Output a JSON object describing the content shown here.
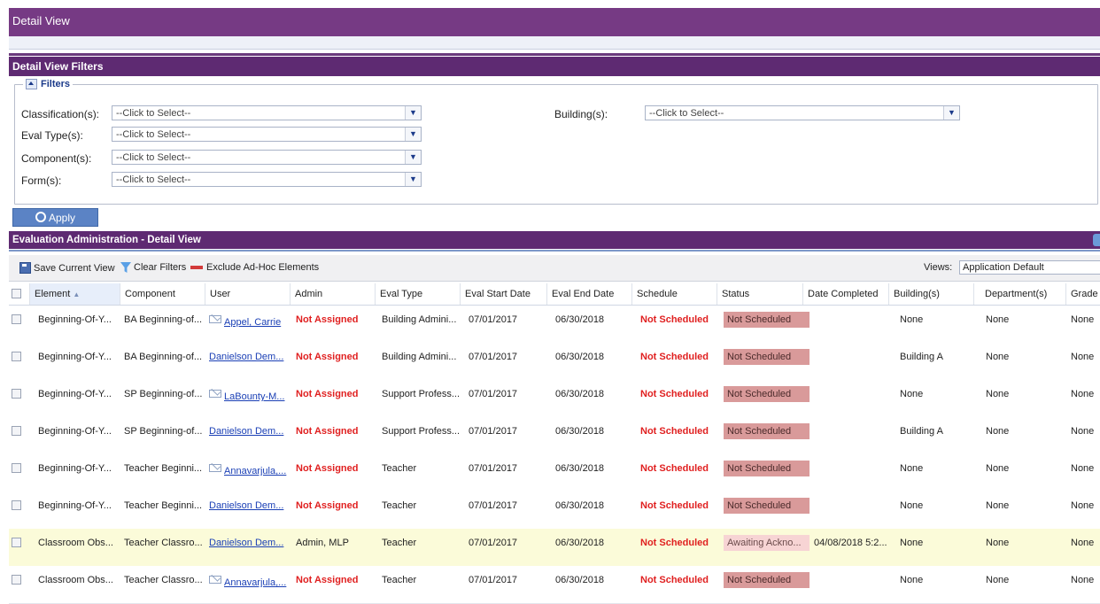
{
  "window": {
    "title": "Detail View"
  },
  "filters_section": {
    "title": "Detail View Filters",
    "legend": "Filters",
    "fields": [
      {
        "label": "Classification(s):",
        "value": "--Click to Select--"
      },
      {
        "label": "Eval Type(s):",
        "value": "--Click to Select--"
      },
      {
        "label": "Component(s):",
        "value": "--Click to Select--"
      },
      {
        "label": "Form(s):",
        "value": "--Click to Select--"
      },
      {
        "label": "Building(s):",
        "value": "--Click to Select--"
      }
    ],
    "apply_label": "Apply"
  },
  "grid": {
    "title": "Evaluation Administration - Detail View",
    "toolbar": {
      "save_label": "Save Current View",
      "clear_label": "Clear Filters",
      "exclude_label": "Exclude Ad-Hoc Elements",
      "views_label": "Views:",
      "views_value": "Application Default"
    },
    "columns": [
      "Element",
      "Component",
      "User",
      "Admin",
      "Eval Type",
      "Eval Start Date",
      "Eval End Date",
      "Schedule",
      "Status",
      "Date Completed",
      "Building(s)",
      "Department(s)",
      "Grade"
    ],
    "sort_indicator": "▲",
    "rows": [
      {
        "element": "Beginning-Of-Y...",
        "component": "BA Beginning-of...",
        "user": "Appel, Carrie",
        "user_email": true,
        "admin": "Not Assigned",
        "eval_type": "Building Admini...",
        "start": "07/01/2017",
        "end": "06/30/2018",
        "schedule": "Not Scheduled",
        "status": "Not Scheduled",
        "completed": "",
        "building": "None",
        "department": "None",
        "grade": "None"
      },
      {
        "element": "Beginning-Of-Y...",
        "component": "BA Beginning-of...",
        "user": "Danielson Dem...",
        "user_email": false,
        "admin": "Not Assigned",
        "eval_type": "Building Admini...",
        "start": "07/01/2017",
        "end": "06/30/2018",
        "schedule": "Not Scheduled",
        "status": "Not Scheduled",
        "completed": "",
        "building": "Building A",
        "department": "None",
        "grade": "None"
      },
      {
        "element": "Beginning-Of-Y...",
        "component": "SP Beginning-of...",
        "user": "LaBounty-M...",
        "user_email": true,
        "admin": "Not Assigned",
        "eval_type": "Support Profess...",
        "start": "07/01/2017",
        "end": "06/30/2018",
        "schedule": "Not Scheduled",
        "status": "Not Scheduled",
        "completed": "",
        "building": "None",
        "department": "None",
        "grade": "None"
      },
      {
        "element": "Beginning-Of-Y...",
        "component": "SP Beginning-of...",
        "user": "Danielson Dem...",
        "user_email": false,
        "admin": "Not Assigned",
        "eval_type": "Support Profess...",
        "start": "07/01/2017",
        "end": "06/30/2018",
        "schedule": "Not Scheduled",
        "status": "Not Scheduled",
        "completed": "",
        "building": "Building A",
        "department": "None",
        "grade": "None"
      },
      {
        "element": "Beginning-Of-Y...",
        "component": "Teacher Beginni...",
        "user": "Annavarjula,...",
        "user_email": true,
        "admin": "Not Assigned",
        "eval_type": "Teacher",
        "start": "07/01/2017",
        "end": "06/30/2018",
        "schedule": "Not Scheduled",
        "status": "Not Scheduled",
        "completed": "",
        "building": "None",
        "department": "None",
        "grade": "None"
      },
      {
        "element": "Beginning-Of-Y...",
        "component": "Teacher Beginni...",
        "user": "Danielson Dem...",
        "user_email": false,
        "admin": "Not Assigned",
        "eval_type": "Teacher",
        "start": "07/01/2017",
        "end": "06/30/2018",
        "schedule": "Not Scheduled",
        "status": "Not Scheduled",
        "completed": "",
        "building": "None",
        "department": "None",
        "grade": "None"
      },
      {
        "element": "Classroom Obs...",
        "component": "Teacher Classro...",
        "user": "Danielson Dem...",
        "user_email": false,
        "admin": "Admin, MLP",
        "eval_type": "Teacher",
        "start": "07/01/2017",
        "end": "06/30/2018",
        "schedule": "Not Scheduled",
        "status": "Awaiting Ackno...",
        "completed": "04/08/2018 5:2...",
        "building": "None",
        "department": "None",
        "grade": "None",
        "highlight": true
      },
      {
        "element": "Classroom Obs...",
        "component": "Teacher Classro...",
        "user": "Annavarjula,...",
        "user_email": true,
        "admin": "Not Assigned",
        "eval_type": "Teacher",
        "start": "07/01/2017",
        "end": "06/30/2018",
        "schedule": "Not Scheduled",
        "status": "Not Scheduled",
        "completed": "",
        "building": "None",
        "department": "None",
        "grade": "None"
      }
    ]
  }
}
